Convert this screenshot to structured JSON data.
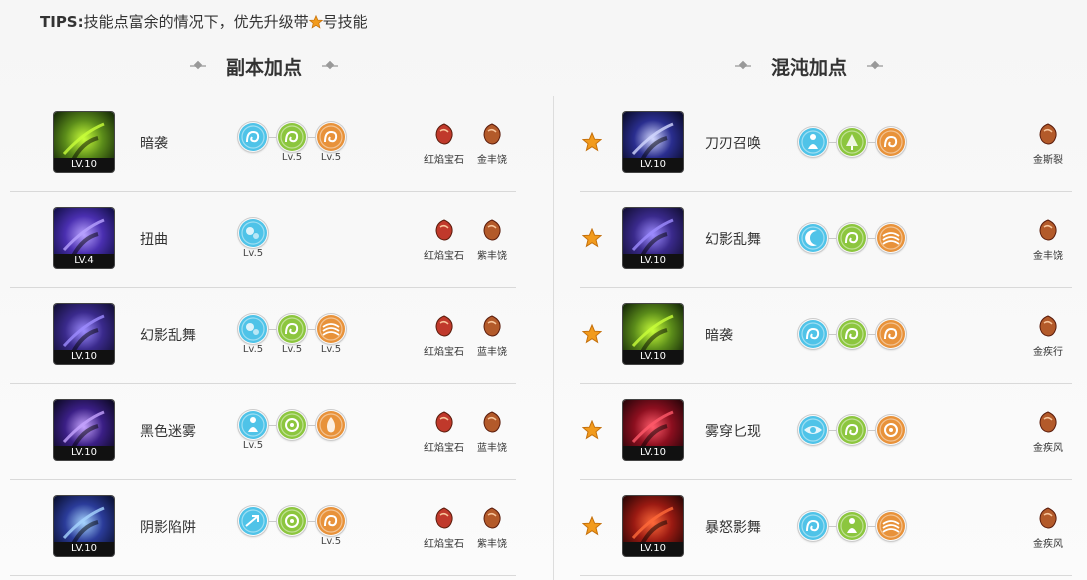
{
  "tips": {
    "prefix": "TIPS:",
    "text_before": "技能点富余的情况下，优先升级带",
    "text_after": "号技能"
  },
  "left_section": {
    "title": "副本加点"
  },
  "right_section": {
    "title": "混沌加点"
  },
  "left_rows": [
    {
      "level": "LV.10",
      "name": "暗袭",
      "icon": "dagger-strike-icon",
      "runes": [
        {
          "kind": "swirl-cyan",
          "lv": ""
        },
        {
          "kind": "coil-green",
          "lv": "Lv.5"
        },
        {
          "kind": "swirl-orange",
          "lv": "Lv.5"
        }
      ],
      "gems": [
        {
          "label": "红焰宝石",
          "color": "red"
        },
        {
          "label": "金丰饶",
          "color": "gold"
        }
      ]
    },
    {
      "level": "LV.4",
      "name": "扭曲",
      "icon": "twist-icon",
      "runes": [
        {
          "kind": "bubble-cyan",
          "lv": "Lv.5"
        }
      ],
      "gems": [
        {
          "label": "红焰宝石",
          "color": "red"
        },
        {
          "label": "紫丰饶",
          "color": "gold"
        }
      ]
    },
    {
      "level": "LV.10",
      "name": "幻影乱舞",
      "icon": "phantom-dance-icon",
      "runes": [
        {
          "kind": "bubble-cyan",
          "lv": "Lv.5"
        },
        {
          "kind": "coil-green",
          "lv": "Lv.5"
        },
        {
          "kind": "wave-orange",
          "lv": "Lv.5"
        }
      ],
      "gems": [
        {
          "label": "红焰宝石",
          "color": "red"
        },
        {
          "label": "蓝丰饶",
          "color": "gold"
        }
      ]
    },
    {
      "level": "LV.10",
      "name": "黑色迷雾",
      "icon": "black-mist-icon",
      "runes": [
        {
          "kind": "figure-cyan",
          "lv": "Lv.5"
        },
        {
          "kind": "ring-green",
          "lv": ""
        },
        {
          "kind": "flame-orange",
          "lv": ""
        }
      ],
      "gems": [
        {
          "label": "红焰宝石",
          "color": "red"
        },
        {
          "label": "蓝丰饶",
          "color": "gold"
        }
      ]
    },
    {
      "level": "LV.10",
      "name": "阴影陷阱",
      "icon": "shadow-trap-icon",
      "runes": [
        {
          "kind": "arrow-cyan",
          "lv": ""
        },
        {
          "kind": "spiral-green",
          "lv": ""
        },
        {
          "kind": "swirl-orange",
          "lv": "Lv.5"
        }
      ],
      "gems": [
        {
          "label": "红焰宝石",
          "color": "red"
        },
        {
          "label": "紫丰饶",
          "color": "gold"
        }
      ]
    }
  ],
  "right_rows": [
    {
      "level": "LV.10",
      "name": "刀刃召唤",
      "icon": "blade-summon-icon",
      "runes": [
        {
          "kind": "figure-cyan"
        },
        {
          "kind": "tree-green"
        },
        {
          "kind": "swirl-orange"
        }
      ],
      "gems": [
        {
          "label": "金斯裂",
          "color": "gold"
        }
      ]
    },
    {
      "level": "LV.10",
      "name": "幻影乱舞",
      "icon": "phantom-dance-icon",
      "runes": [
        {
          "kind": "moon-cyan"
        },
        {
          "kind": "coil-green"
        },
        {
          "kind": "wave-orange"
        }
      ],
      "gems": [
        {
          "label": "金丰饶",
          "color": "gold"
        }
      ]
    },
    {
      "level": "LV.10",
      "name": "暗袭",
      "icon": "dagger-strike-icon",
      "runes": [
        {
          "kind": "swirl-cyan"
        },
        {
          "kind": "coil-green"
        },
        {
          "kind": "swirl-orange"
        }
      ],
      "gems": [
        {
          "label": "金疾行",
          "color": "gold"
        }
      ]
    },
    {
      "level": "LV.10",
      "name": "雾穿匕现",
      "icon": "mist-dagger-icon",
      "runes": [
        {
          "kind": "eye-cyan"
        },
        {
          "kind": "coil-green"
        },
        {
          "kind": "spiral-orange"
        }
      ],
      "gems": [
        {
          "label": "金疾风",
          "color": "gold"
        }
      ]
    },
    {
      "level": "LV.10",
      "name": "暴怒影舞",
      "icon": "rage-shadow-icon",
      "runes": [
        {
          "kind": "coil-cyan"
        },
        {
          "kind": "figure-green"
        },
        {
          "kind": "wave-orange"
        }
      ],
      "gems": [
        {
          "label": "金疾风",
          "color": "gold"
        }
      ]
    }
  ],
  "colors": {
    "cyan": "#4fc3e8",
    "green": "#8cc63e",
    "orange": "#e8923a",
    "star": "#f29b1d",
    "gem_red": "#c0392b",
    "gem_gold": "#b35a2a"
  }
}
